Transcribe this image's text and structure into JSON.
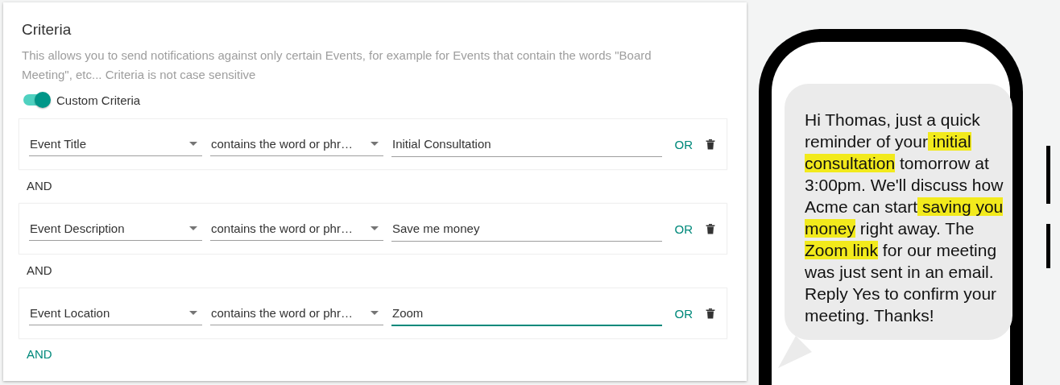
{
  "criteria": {
    "title": "Criteria",
    "description": "This allows you to send notifications against only certain Events, for example for Events that contain the words \"Board Meeting\", etc... Criteria is not case sensitive",
    "custom_criteria": {
      "label": "Custom Criteria",
      "on": true
    },
    "rules": [
      {
        "field": "Event Title",
        "operator": "contains the word or phr…",
        "value": "Initial Consultation",
        "focused": false,
        "or_label": "OR"
      },
      {
        "field": "Event Description",
        "operator": "contains the word or phr…",
        "value": "Save me money",
        "focused": false,
        "or_label": "OR"
      },
      {
        "field": "Event Location",
        "operator": "contains the word or phr…",
        "value": "Zoom",
        "focused": true,
        "or_label": "OR"
      }
    ],
    "joiners": [
      "AND",
      "AND"
    ],
    "add_button": "AND"
  },
  "message": {
    "segments": [
      {
        "text": "Hi Thomas, just a quick reminder of your",
        "highlighted": false
      },
      {
        "text": " initial consultation",
        "highlighted": true
      },
      {
        "text": " tomorrow at 3:00pm. We'll discuss how Acme can start",
        "highlighted": false
      },
      {
        "text": " saving you money",
        "highlighted": true
      },
      {
        "text": " right away. The ",
        "highlighted": false
      },
      {
        "text": "Zoom link",
        "highlighted": true
      },
      {
        "text": " for our meeting was just sent in an email. Reply Yes to confirm your meeting. Thanks!",
        "highlighted": false
      }
    ]
  }
}
